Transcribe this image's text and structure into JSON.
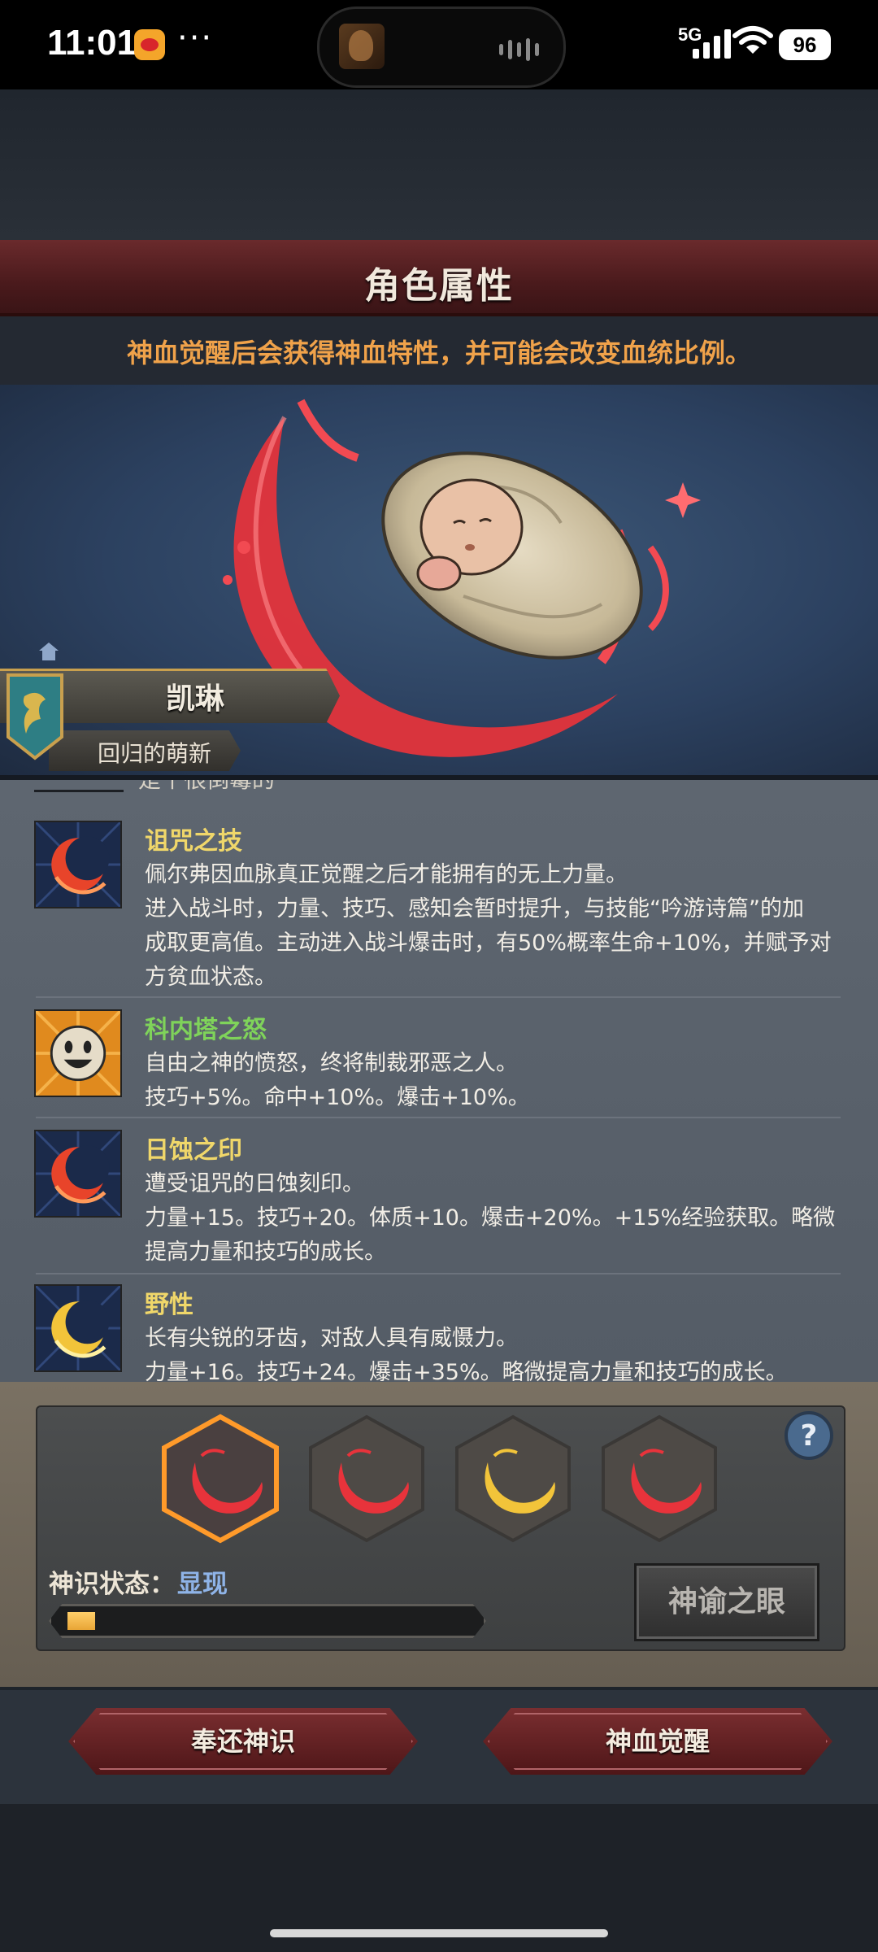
{
  "status_bar": {
    "time": "11:01",
    "notification_icon": "weibo-icon",
    "more": "···",
    "network": "5G",
    "battery": "96"
  },
  "header": {
    "title": "角色属性",
    "subtitle": "神血觉醒后会获得神血特性，并可能会改变血统比例。"
  },
  "character": {
    "name": "凯琳",
    "title": "回归的萌新"
  },
  "traits": {
    "cut_off_text": "是个很倒霉的",
    "items": [
      {
        "name": "诅咒之技",
        "name_color": "#f0d76a",
        "icon": "crimson-moon-icon",
        "desc": [
          "佩尔弗因血脉真正觉醒之后才能拥有的无上力量。",
          "进入战斗时，力量、技巧、感知会暂时提升，与技能“吟游诗篇”的加",
          "成取更高值。主动进入战斗爆击时，有50%概率生命+10%，并赋予对",
          "方贫血状态。"
        ]
      },
      {
        "name": "科内塔之怒",
        "name_color": "#7fd35a",
        "icon": "smiling-face-icon",
        "desc": [
          "自由之神的愤怒，终将制裁邪恶之人。",
          "技巧+5%。命中+10%。爆击+10%。"
        ]
      },
      {
        "name": "日蚀之印",
        "name_color": "#f0d76a",
        "icon": "crimson-moon-icon",
        "desc": [
          "遭受诅咒的日蚀刻印。",
          "力量+15。技巧+20。体质+10。爆击+20%。+15%经验获取。略微",
          "提高力量和技巧的成长。"
        ]
      },
      {
        "name": "野性",
        "name_color": "#f0d76a",
        "icon": "golden-moon-icon",
        "desc": [
          "长有尖锐的牙齿，对敌人具有威慑力。",
          "力量+16。技巧+24。爆击+35%。略微提高力量和技巧的成长。"
        ]
      }
    ]
  },
  "bloodline_panel": {
    "slots": [
      {
        "icon": "crimson-moon-icon",
        "selected": true
      },
      {
        "icon": "crimson-moon-icon",
        "selected": false
      },
      {
        "icon": "golden-moon-icon",
        "selected": false
      },
      {
        "icon": "crimson-moon-icon",
        "selected": false
      }
    ],
    "state_label": "神识状态：",
    "state_value": "显现",
    "progress": 0.07,
    "oracle_button": "神谕之眼",
    "help_icon": "question-mark-icon"
  },
  "actions": {
    "return_button": "奉还神识",
    "awaken_button": "神血觉醒"
  },
  "colors": {
    "accent_orange": "#f0a24a",
    "banner_red": "#5a2022",
    "state_blue": "#8fb4e8",
    "selected_hex": "#ff9a2a"
  }
}
